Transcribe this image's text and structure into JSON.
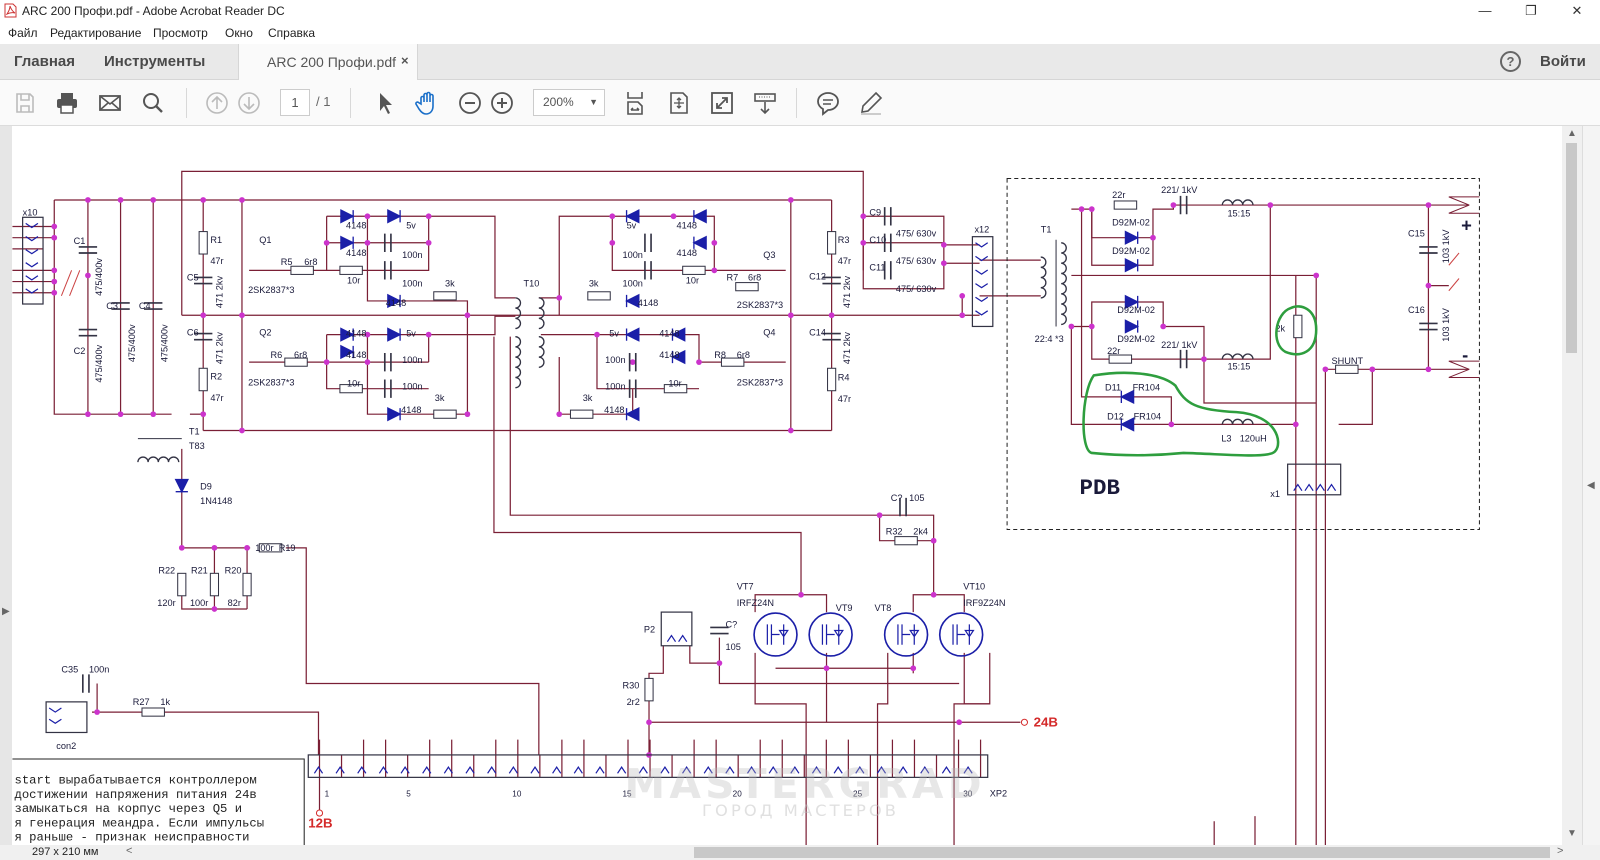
{
  "window": {
    "title": "ARC 200 Профи.pdf - Adobe Acrobat Reader DC",
    "minimize": "—",
    "restore": "❐",
    "close": "✕"
  },
  "menu": {
    "items": [
      "Файл",
      "Редактирование",
      "Просмотр",
      "Окно",
      "Справка"
    ]
  },
  "tabs": {
    "home": "Главная",
    "tools": "Инструменты",
    "document": "ARC 200 Профи.pdf",
    "close": "×",
    "help": "?",
    "signin": "Войти"
  },
  "toolbar": {
    "icons": [
      "save-icon",
      "print-icon",
      "mail-icon",
      "search-icon",
      "page-up-icon",
      "page-down-icon",
      "select-cursor-icon",
      "hand-tool-icon",
      "zoom-out-icon",
      "zoom-in-icon",
      "fit-page-icon",
      "rotate-icon",
      "fullscreen-icon",
      "scroll-mode-icon",
      "comment-icon",
      "pen-icon"
    ],
    "page_current": "1",
    "page_total": "/ 1",
    "zoom": "200%",
    "active_tool": "hand-tool"
  },
  "colors": {
    "wire": "#7a1f35",
    "junction": "#cc33cc",
    "diode": "#1b1fa8",
    "label": "#1a1a3a",
    "red_label": "#d42a2a",
    "highlight": "#2e9e3e",
    "hand_tool_active": "#1a6fc9"
  },
  "schematic": {
    "labels": [
      "x10",
      "C1",
      "475/400v",
      "C2",
      "475/400v",
      "C3",
      "475/400v",
      "C4",
      "475/400v",
      "R1",
      "47r",
      "C5",
      "471 2kv",
      "C6",
      "471 2kv",
      "R2",
      "47r",
      "Q1",
      "R5",
      "6r8",
      "2SK2837*3",
      "Q2",
      "R6",
      "6r8",
      "2SK2837*3",
      "T1",
      "T83",
      "D9",
      "1N4148",
      "R22",
      "R21",
      "R20",
      "120r",
      "100r",
      "82r",
      "100r",
      "R19",
      "C35",
      "100n",
      "R27",
      "1k",
      "con2",
      "T10",
      "Q3",
      "R7",
      "6r8",
      "2SK2837*3",
      "Q4",
      "R8",
      "6r8",
      "2SK2837*3",
      "R3",
      "47r",
      "C12",
      "471 2kv",
      "C14",
      "471 2kv",
      "R4",
      "47r",
      "C9",
      "C10",
      "C11",
      "475/ 630v",
      "475/ 630v",
      "475/ 630v",
      "x12",
      "T1",
      "22:4 *3",
      "22r",
      "221/ 1kV",
      "15:15",
      "D92M-02",
      "D92M-02",
      "D92M-02",
      "D92M-02",
      "22r",
      "221/ 1kV",
      "15:15",
      "2k",
      "SHUNT",
      "C15",
      "103 1kV",
      "C16",
      "103 1kV",
      "+",
      "-",
      "D11",
      "FR104",
      "D12",
      "FR104",
      "L3",
      "120uH",
      "PDB",
      "x1",
      "C?",
      "105",
      "R32",
      "2k4",
      "VT7",
      "IRFZ24N",
      "VT9",
      "VT8",
      "VT10",
      "IRF9Z24N",
      "P2",
      "C?",
      "105",
      "R30",
      "2r2",
      "24В",
      "XP2",
      "1",
      "5",
      "10",
      "15",
      "20",
      "25",
      "30",
      "12В",
      "4148",
      "5v",
      "4148",
      "100n",
      "10r",
      "100n",
      "4148",
      "3k",
      "4148",
      "5v",
      "4148",
      "100n",
      "10r",
      "100n",
      "4148",
      "3k",
      "5v",
      "4148",
      "100n",
      "4148",
      "100n",
      "10r",
      "3k",
      "4148",
      "5v",
      "4148",
      "100n",
      "4148",
      "100n",
      "10r",
      "3k",
      "4148"
    ],
    "note_lines": [
      "start вырабатывается контроллером",
      " достижении напряжения питания 24в",
      " замыкаться на корпус через Q5 и",
      "я генерация меандра. Если импульсы",
      "я раньше - признак неисправности"
    ],
    "watermark": [
      "MASTERGRAD",
      "ГОРОД МАСТЕРОВ"
    ]
  },
  "status": {
    "page_size": "297 x 210 мм",
    "scroll_left": "<",
    "scroll_right": ">"
  }
}
